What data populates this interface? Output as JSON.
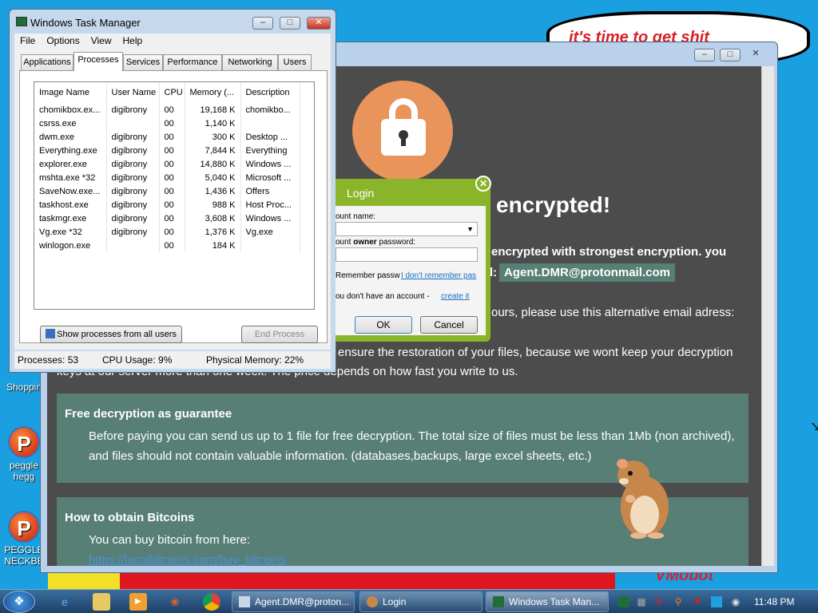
{
  "wallpaper": {
    "cloud_text": "it's time to get shit",
    "corner_text": "VMobot"
  },
  "desktop_icons": [
    {
      "label": "Shoppin"
    },
    {
      "label": "peggle hegg"
    },
    {
      "label": "PEGGLE NECKBE"
    }
  ],
  "ransom": {
    "heading": "encrypted!",
    "line1": "encrypted with strongest encryption. you",
    "line2_prefix": "l:",
    "email": "Agent.DMR@protonmail.com",
    "line3": "ours, please use this alternative email adress:",
    "line4": "ensure the restoration of your files, because we wont keep your decryption",
    "line5": "keys at our server more than one week.  The price depends on how fast you write to us.",
    "panel1_title": "Free decryption as guarantee",
    "panel1_text": "Before paying you can send us up to 1 file for free decryption. The total size of files must be less than 1Mb (non archived), and files should not contain valuable information. (databases,backups, large excel sheets, etc.)",
    "panel2_title": "How to obtain Bitcoins",
    "panel2_text": "You can buy bitcoin from here:",
    "panel2_link": "https://localbitcoins.com/buy_bitcoins"
  },
  "task_manager": {
    "title": "Windows Task Manager",
    "menu": [
      "File",
      "Options",
      "View",
      "Help"
    ],
    "tabs": [
      "Applications",
      "Processes",
      "Services",
      "Performance",
      "Networking",
      "Users"
    ],
    "active_tab": "Processes",
    "columns": [
      "Image Name",
      "User Name",
      "CPU",
      "Memory (...",
      "Description"
    ],
    "rows": [
      [
        "chomikbox.ex...",
        "digibrony",
        "00",
        "19,168 K",
        "chomikbo..."
      ],
      [
        "csrss.exe",
        "",
        "00",
        "1,140 K",
        ""
      ],
      [
        "dwm.exe",
        "digibrony",
        "00",
        "300 K",
        "Desktop ..."
      ],
      [
        "Everything.exe",
        "digibrony",
        "00",
        "7,844 K",
        "Everything"
      ],
      [
        "explorer.exe",
        "digibrony",
        "00",
        "14,880 K",
        "Windows ..."
      ],
      [
        "mshta.exe *32",
        "digibrony",
        "00",
        "5,040 K",
        "Microsoft ..."
      ],
      [
        "SaveNow.exe...",
        "digibrony",
        "00",
        "1,436 K",
        "Offers"
      ],
      [
        "taskhost.exe",
        "digibrony",
        "00",
        "988 K",
        "Host Proc..."
      ],
      [
        "taskmgr.exe",
        "digibrony",
        "00",
        "3,608 K",
        "Windows ..."
      ],
      [
        "Vg.exe *32",
        "digibrony",
        "00",
        "1,376 K",
        "Vg.exe"
      ],
      [
        "winlogon.exe",
        "",
        "00",
        "184 K",
        ""
      ]
    ],
    "show_all_label": "Show processes from all users",
    "end_process_label": "End Process",
    "status_processes": "Processes: 53",
    "status_cpu": "CPU Usage: 9%",
    "status_memory": "Physical Memory: 22%"
  },
  "login": {
    "title": "Login",
    "account_label": "ount name:",
    "password_label_pre": "ount ",
    "password_label_bold": "owner",
    "password_label_post": " password:",
    "remember": "Remember passw",
    "forgot": "I don't remember pas",
    "no_account": "ou don't have an account -",
    "create": "create it",
    "ok": "OK",
    "cancel": "Cancel"
  },
  "taskbar": {
    "buttons": [
      "Agent.DMR@proton...",
      "Login",
      "Windows Task Man..."
    ],
    "clock": "11:48 PM"
  }
}
